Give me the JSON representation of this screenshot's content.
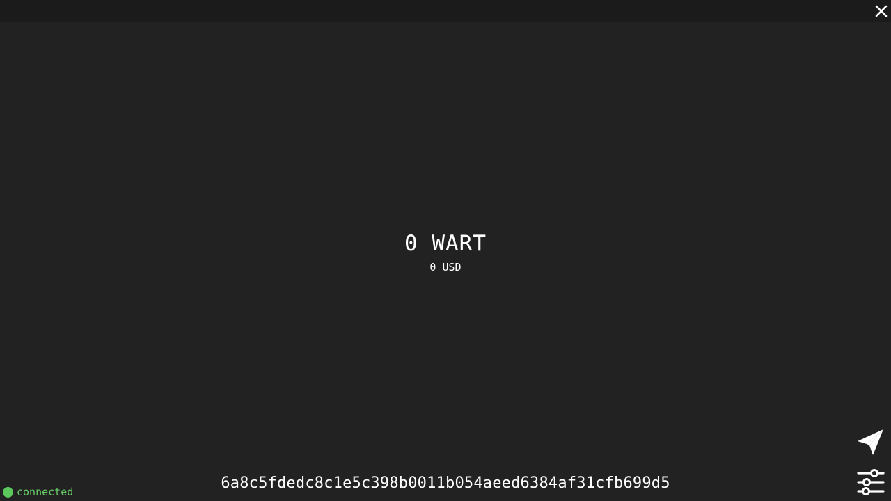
{
  "window": {
    "close_icon": "close-icon"
  },
  "balance": {
    "amount": "0 WART",
    "fiat": "0 USD"
  },
  "wallet": {
    "address": "6a8c5fdedc8c1e5c398b0011b054aeed6384af31cfb699d5"
  },
  "status": {
    "label": "connected",
    "color": "#5cc85c"
  },
  "actions": {
    "send_icon": "send-icon",
    "settings_icon": "settings-sliders-icon"
  },
  "colors": {
    "background": "#222222",
    "titlebar": "#1b1b1b",
    "text": "#ffffff",
    "status_text": "#66cc66"
  }
}
